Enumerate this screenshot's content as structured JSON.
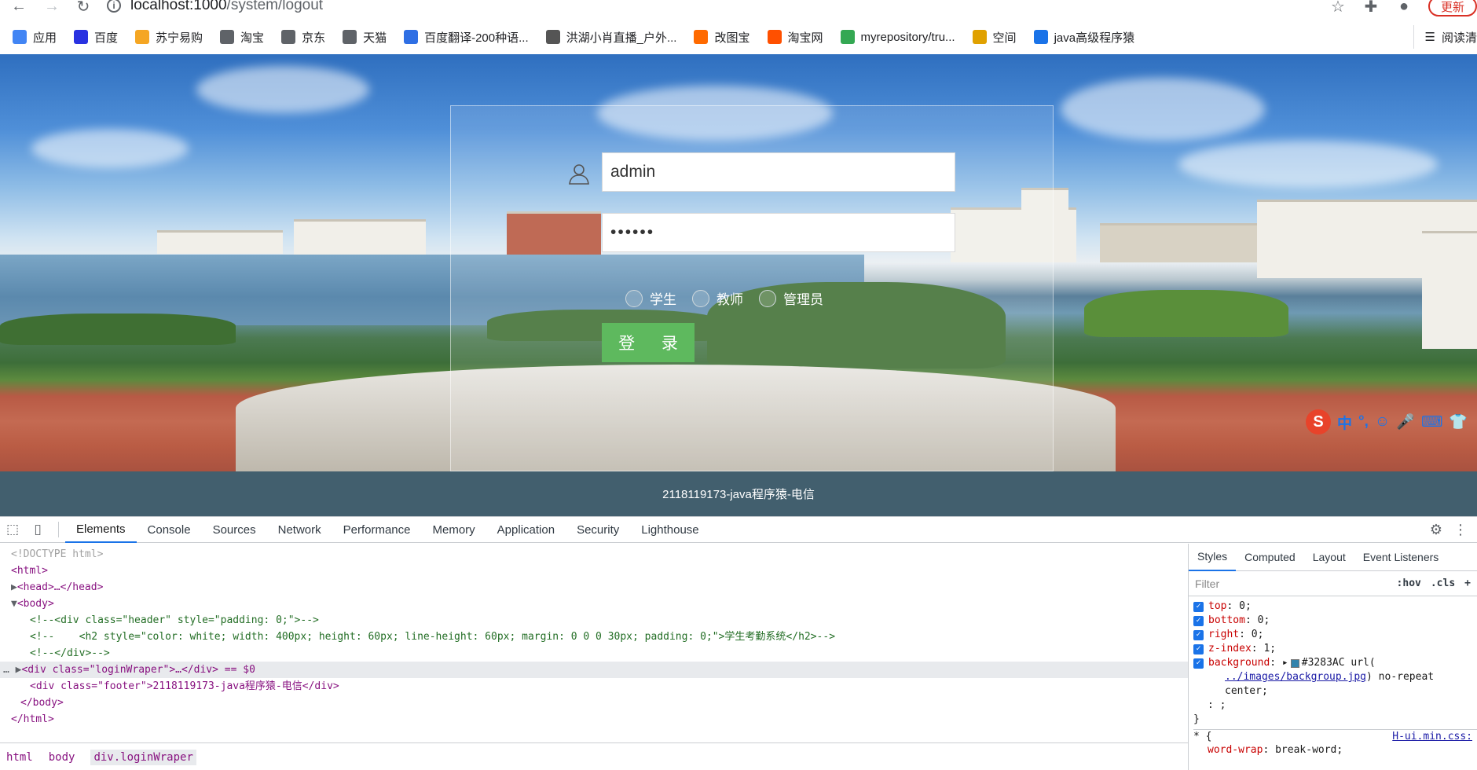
{
  "browser": {
    "url_host": "localhost:1000",
    "url_path": "/system/logout",
    "update_label": "更新",
    "bookmarks": [
      {
        "label": "应用",
        "color": "#4285f4"
      },
      {
        "label": "百度",
        "color": "#2932e1"
      },
      {
        "label": "苏宁易购",
        "color": "#f5a623"
      },
      {
        "label": "淘宝",
        "color": "#5f6368"
      },
      {
        "label": "京东",
        "color": "#5f6368"
      },
      {
        "label": "天猫",
        "color": "#5f6368"
      },
      {
        "label": "百度翻译-200种语...",
        "color": "#2f6fe4"
      },
      {
        "label": "洪湖小肖直播_户外...",
        "color": "#555555"
      },
      {
        "label": "改图宝",
        "color": "#ff6a00"
      },
      {
        "label": "淘宝网",
        "color": "#ff5000"
      },
      {
        "label": "myrepository/tru...",
        "color": "#34a853"
      },
      {
        "label": "空间",
        "color": "#e0a100"
      },
      {
        "label": "java高级程序猿",
        "color": "#1a73e8"
      }
    ],
    "reading_list_label": "阅读清"
  },
  "login": {
    "username_value": "admin",
    "password_value": "••••••",
    "roles": [
      "学生",
      "教师",
      "管理员"
    ],
    "login_button_label": "登  录"
  },
  "ime": {
    "logo": "S",
    "items": [
      "中",
      "°,",
      "☺",
      "🎤",
      "⌨",
      "👕"
    ]
  },
  "footer": {
    "text": "2118119173-java程序猿-电信"
  },
  "devtools": {
    "tabs": [
      "Elements",
      "Console",
      "Sources",
      "Network",
      "Performance",
      "Memory",
      "Application",
      "Security",
      "Lighthouse"
    ],
    "active_tab": "Elements",
    "dom_lines": [
      "<!DOCTYPE html>",
      "<html>",
      "<head>…</head>",
      "<body>",
      "<!--<div class=\"header\" style=\"padding: 0;\">-->",
      "<!--    <h2 style=\"color: white; width: 400px; height: 60px; line-height: 60px; margin: 0 0 0 30px; padding: 0;\">学生考勤系统</h2>-->",
      "<!--</div>-->",
      "<div class=\"loginWraper\">…</div> == $0",
      "<div class=\"footer\">2118119173-java程序猿-电信</div>",
      "</body>",
      "</html>"
    ],
    "breadcrumbs": [
      "html",
      "body",
      "div.loginWraper"
    ],
    "styles_tabs": [
      "Styles",
      "Computed",
      "Layout",
      "Event Listeners"
    ],
    "filter_placeholder": "Filter",
    "hov_label": ":hov",
    "cls_label": ".cls",
    "rules": [
      {
        "prop": "top",
        "value": "0;"
      },
      {
        "prop": "bottom",
        "value": "0;"
      },
      {
        "prop": "right",
        "value": "0;"
      },
      {
        "prop": "z-index",
        "value": "1;"
      }
    ],
    "background_rule": {
      "prop": "background",
      "color": "#3283AC",
      "url_prefix": "url(",
      "url": "../images/backgroup.jpg",
      "after_url": ") no-repeat",
      "last": "center;"
    },
    "semicolon_line": ": ;",
    "next_selector": "* {",
    "next_source": "H-ui.min.css:",
    "next_rule": {
      "prop": "word-wrap",
      "value": "break-word;"
    }
  }
}
